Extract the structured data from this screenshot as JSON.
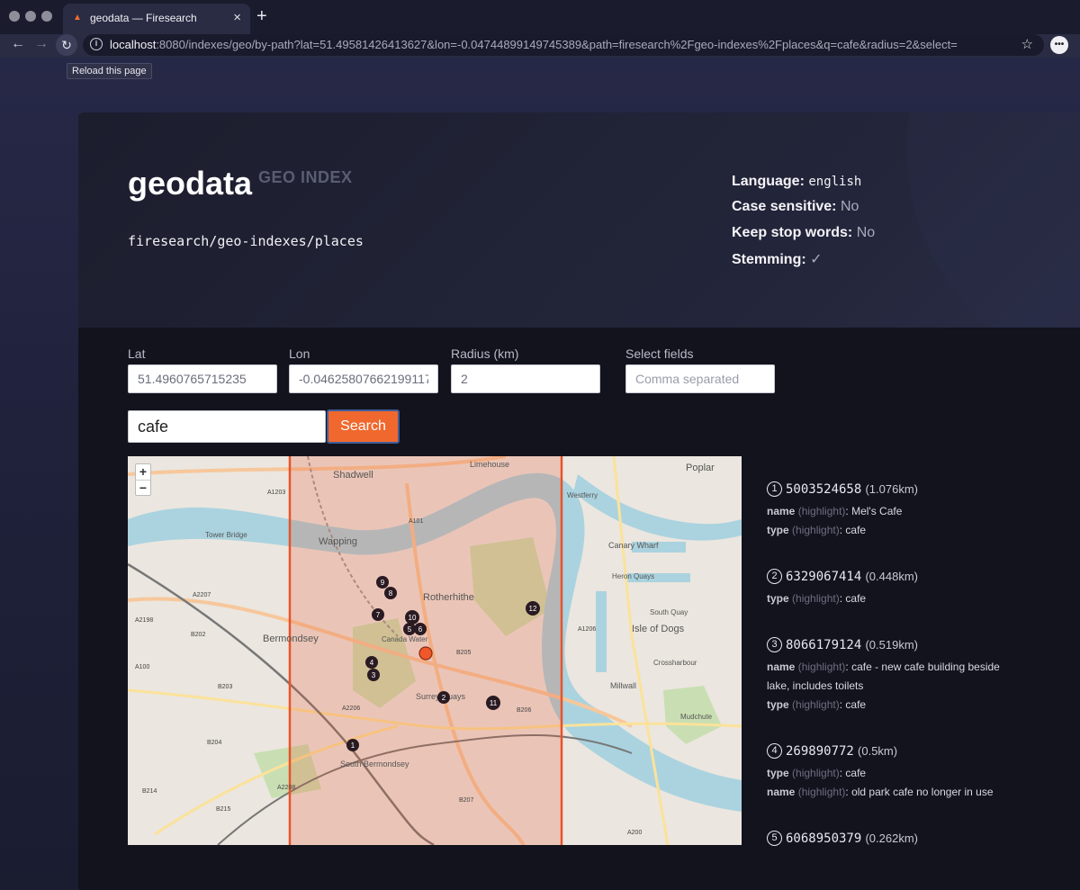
{
  "browser": {
    "tab_title": "geodata — Firesearch",
    "tab_icon": "firesearch-flame-icon",
    "url_host": "localhost",
    "url_rest": ":8080/indexes/geo/by-path?lat=51.49581426413627&lon=-0.04744899149745389&path=firesearch%2Fgeo-indexes%2Fplaces&q=cafe&radius=2&select=",
    "reload_tooltip": "Reload this page"
  },
  "index": {
    "name": "geodata",
    "type_label": "GEO INDEX",
    "path": "firesearch/geo-indexes/places"
  },
  "meta": {
    "language_label": "Language:",
    "language_value": "english",
    "case_label": "Case sensitive:",
    "case_value": "No",
    "stop_label": "Keep stop words:",
    "stop_value": "No",
    "stemming_label": "Stemming:",
    "stemming_value": "✓"
  },
  "form": {
    "lat_label": "Lat",
    "lat_value": "51.4960765715235",
    "lon_label": "Lon",
    "lon_value": "-0.04625807662199117",
    "radius_label": "Radius (km)",
    "radius_value": "2",
    "select_label": "Select fields",
    "select_placeholder": "Comma separated",
    "query_value": "cafe",
    "search_label": "Search"
  },
  "map": {
    "zoom_in": "+",
    "zoom_out": "−",
    "labels": [
      "Shadwell",
      "Wapping",
      "Rotherhithe",
      "Bermondsey",
      "Canada Water",
      "Surrey Quays",
      "South Bermondsey",
      "Millwall",
      "Isle of Dogs",
      "Canary Wharf",
      "Poplar",
      "Limehouse",
      "Tower Bridge",
      "Crossharbour",
      "Mudchute",
      "South Quay",
      "Heron Quays",
      "Westferry"
    ],
    "road_labels": [
      "A1203",
      "A101",
      "A2207",
      "A2198",
      "B202",
      "A100",
      "B203",
      "B204",
      "B205",
      "B206",
      "A2206",
      "A2208",
      "B207",
      "A200",
      "A1206",
      "B214",
      "B215"
    ],
    "markers": [
      "1",
      "2",
      "3",
      "4",
      "5",
      "6",
      "7",
      "8",
      "9",
      "10",
      "11",
      "12"
    ],
    "accent_color": "#e8532a"
  },
  "results": [
    {
      "num": "1",
      "id": "5003524658",
      "dist": "(1.076km)",
      "fields": [
        {
          "name": "name",
          "hl": "(highlight)",
          "value": ": Mel's Cafe"
        },
        {
          "name": "type",
          "hl": "(highlight)",
          "value": ": cafe"
        }
      ]
    },
    {
      "num": "2",
      "id": "6329067414",
      "dist": "(0.448km)",
      "fields": [
        {
          "name": "type",
          "hl": "(highlight)",
          "value": ": cafe"
        }
      ]
    },
    {
      "num": "3",
      "id": "8066179124",
      "dist": "(0.519km)",
      "fields": [
        {
          "name": "name",
          "hl": "(highlight)",
          "value": ": cafe - new cafe building beside lake, includes toilets"
        },
        {
          "name": "type",
          "hl": "(highlight)",
          "value": ": cafe"
        }
      ]
    },
    {
      "num": "4",
      "id": "269890772",
      "dist": "(0.5km)",
      "fields": [
        {
          "name": "type",
          "hl": "(highlight)",
          "value": ": cafe"
        },
        {
          "name": "name",
          "hl": "(highlight)",
          "value": ": old park cafe no longer in use"
        }
      ]
    },
    {
      "num": "5",
      "id": "6068950379",
      "dist": "(0.262km)",
      "fields": []
    }
  ]
}
